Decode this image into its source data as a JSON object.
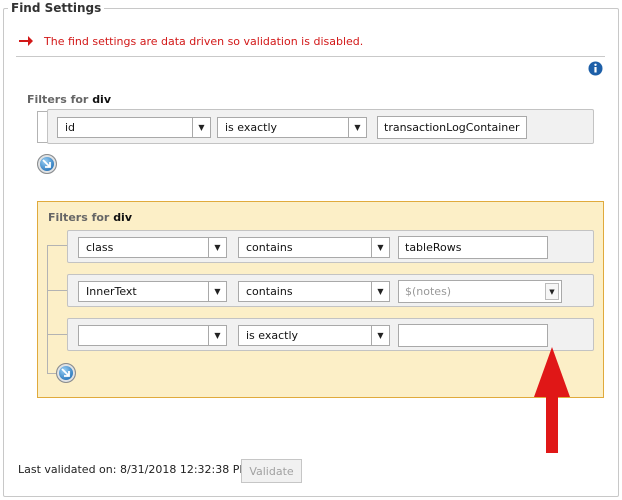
{
  "panel": {
    "title": "Find Settings"
  },
  "warning": {
    "icon": "red-arrow-icon",
    "text": "The find settings are data driven so validation is disabled.",
    "color": "#d21818"
  },
  "info_icon": "info-icon",
  "outer_filter": {
    "title_prefix": "Filters for",
    "element": "div",
    "rows": [
      {
        "attribute": "id",
        "operator": "is exactly",
        "value": "transactionLogContainer"
      }
    ]
  },
  "inner_filter": {
    "title_prefix": "Filters for",
    "element": "div",
    "highlight_color": "#fcefc7",
    "rows": [
      {
        "attribute": "class",
        "operator": "contains",
        "value": "tableRows",
        "placeholder": ""
      },
      {
        "attribute": "InnerText",
        "operator": "contains",
        "value": "",
        "placeholder": "$(notes)"
      },
      {
        "attribute": "",
        "operator": "is exactly",
        "value": "",
        "placeholder": ""
      }
    ]
  },
  "footer": {
    "last_validated": "Last validated on: 8/31/2018 12:32:38 PM",
    "validate_label": "Validate"
  },
  "annotation": {
    "icon": "red-up-arrow",
    "color": "#e01717"
  }
}
